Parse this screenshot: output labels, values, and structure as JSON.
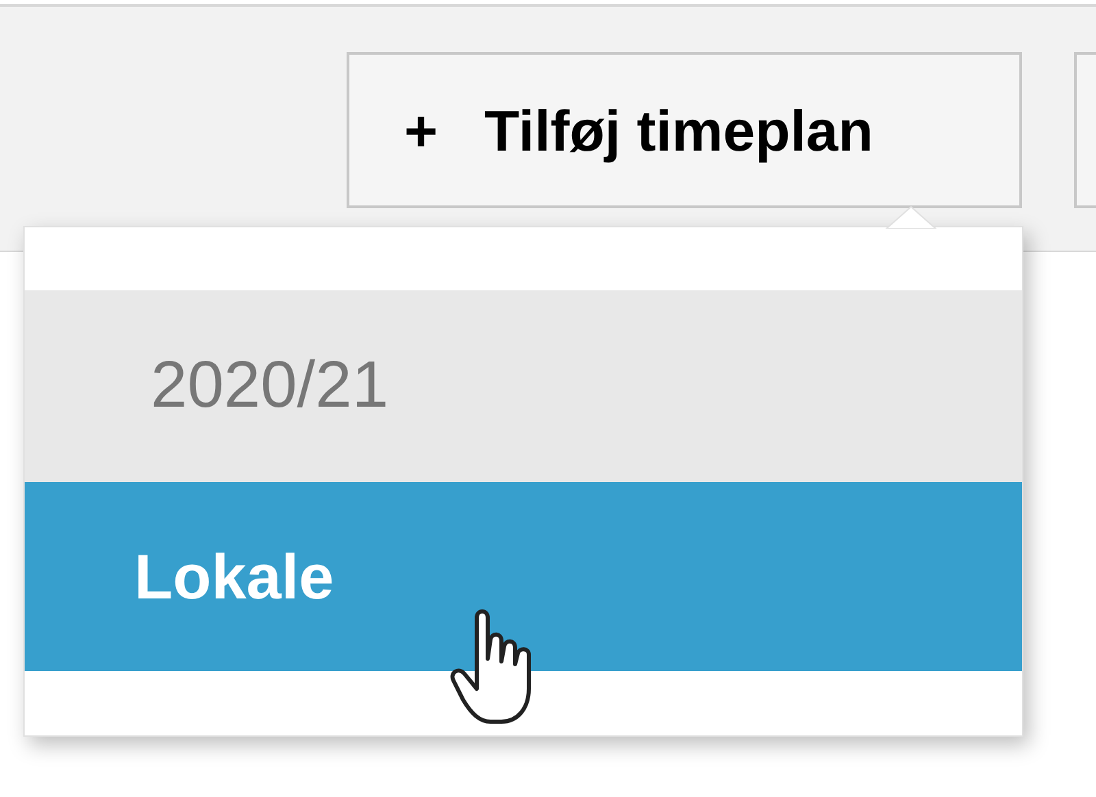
{
  "toolbar": {
    "add_button": {
      "icon": "+",
      "label": "Tilføj timeplan"
    }
  },
  "menu": {
    "items": [
      {
        "kind": "header",
        "label": "2020/21",
        "selected": false
      },
      {
        "kind": "option",
        "label": "Lokale",
        "selected": true
      }
    ]
  }
}
